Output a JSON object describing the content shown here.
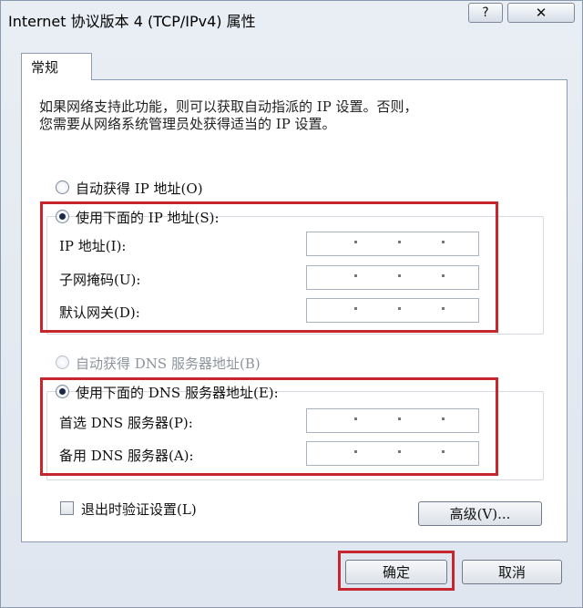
{
  "window": {
    "title": "Internet 协议版本 4 (TCP/IPv4) 属性",
    "help_glyph": "?",
    "close_glyph": "✕"
  },
  "tab": {
    "label": "常规"
  },
  "description": {
    "line1": "如果网络支持此功能，则可以获取自动指派的 IP 设置。否则，",
    "line2": "您需要从网络系统管理员处获得适当的 IP 设置。"
  },
  "ip_section": {
    "auto_label": "自动获得 IP 地址(O)",
    "manual_label": "使用下面的 IP 地址(S):",
    "fields": [
      {
        "label": "IP 地址(I):",
        "value": ""
      },
      {
        "label": "子网掩码(U):",
        "value": ""
      },
      {
        "label": "默认网关(D):",
        "value": ""
      }
    ],
    "selected": "manual"
  },
  "dns_section": {
    "auto_label": "自动获得 DNS 服务器地址(B)",
    "manual_label": "使用下面的 DNS 服务器地址(E):",
    "fields": [
      {
        "label": "首选 DNS 服务器(P):",
        "value": ""
      },
      {
        "label": "备用 DNS 服务器(A):",
        "value": ""
      }
    ],
    "selected": "manual"
  },
  "validate_checkbox": {
    "label": "退出时验证设置(L)",
    "checked": false
  },
  "buttons": {
    "advanced": "高级(V)...",
    "ok": "确定",
    "cancel": "取消"
  },
  "colors": {
    "highlight": "#c8262e"
  }
}
